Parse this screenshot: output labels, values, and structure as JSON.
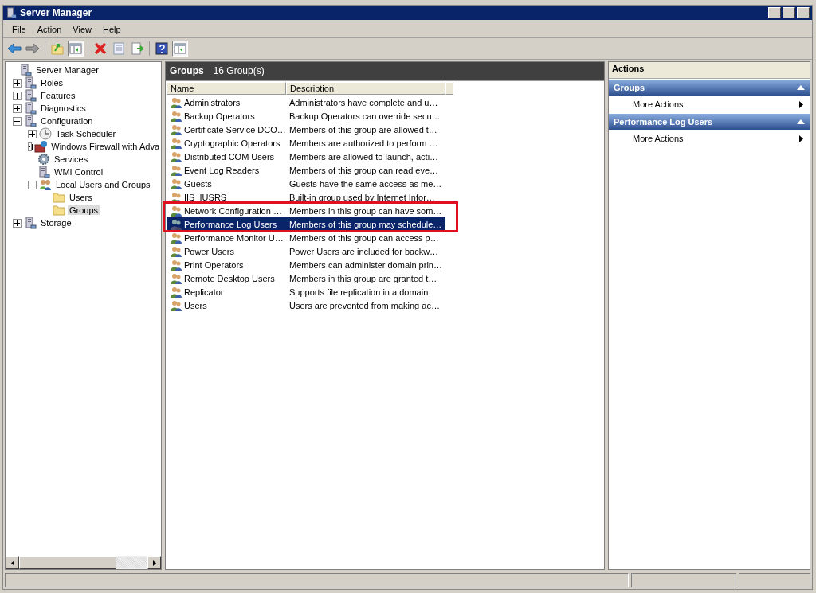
{
  "window": {
    "title": "Server Manager"
  },
  "menu": [
    "File",
    "Action",
    "View",
    "Help"
  ],
  "toolbar": [
    {
      "kind": "back",
      "pressed": false
    },
    {
      "kind": "forward",
      "pressed": false
    },
    {
      "kind": "sep"
    },
    {
      "kind": "up",
      "pressed": false
    },
    {
      "kind": "pane",
      "pressed": true
    },
    {
      "kind": "sep"
    },
    {
      "kind": "delete",
      "pressed": false
    },
    {
      "kind": "properties",
      "pressed": false
    },
    {
      "kind": "export",
      "pressed": false
    },
    {
      "kind": "sep"
    },
    {
      "kind": "help",
      "pressed": false
    },
    {
      "kind": "pane",
      "pressed": true
    }
  ],
  "tree": [
    {
      "label": "Server Manager",
      "kind": "server",
      "selected": false,
      "children": [
        {
          "label": "Roles",
          "kind": "server",
          "expanded": false,
          "selected": false
        },
        {
          "label": "Features",
          "kind": "server",
          "expanded": false,
          "selected": false
        },
        {
          "label": "Diagnostics",
          "kind": "server",
          "expanded": false,
          "selected": false
        },
        {
          "label": "Configuration",
          "kind": "server",
          "expanded": true,
          "selected": false,
          "children": [
            {
              "label": "Task Scheduler",
              "kind": "clock",
              "expanded": false,
              "selected": false
            },
            {
              "label": "Windows Firewall with Adva",
              "kind": "wall",
              "expanded": false,
              "selected": false
            },
            {
              "label": "Services",
              "kind": "gear",
              "selected": false
            },
            {
              "label": "WMI Control",
              "kind": "server",
              "selected": false
            },
            {
              "label": "Local Users and Groups",
              "kind": "users",
              "expanded": true,
              "selected": false,
              "children": [
                {
                  "label": "Users",
                  "kind": "folder",
                  "selected": false
                },
                {
                  "label": "Groups",
                  "kind": "folder",
                  "selected": true
                }
              ]
            }
          ]
        },
        {
          "label": "Storage",
          "kind": "server",
          "expanded": false,
          "selected": false
        }
      ]
    }
  ],
  "groups": {
    "title": "Groups",
    "count": "16 Group(s)",
    "columns": [
      "Name",
      "Description"
    ],
    "rows": [
      {
        "name": "Administrators",
        "description": "Administrators have complete and u…",
        "selected": false,
        "annotated": false
      },
      {
        "name": "Backup Operators",
        "description": "Backup Operators can override secu…",
        "selected": false,
        "annotated": false
      },
      {
        "name": "Certificate Service DCO…",
        "description": "Members of this group are allowed t…",
        "selected": false,
        "annotated": false
      },
      {
        "name": "Cryptographic Operators",
        "description": "Members are authorized to perform …",
        "selected": false,
        "annotated": false
      },
      {
        "name": "Distributed COM Users",
        "description": "Members are allowed to launch, acti…",
        "selected": false,
        "annotated": false
      },
      {
        "name": "Event Log Readers",
        "description": "Members of this group can read eve…",
        "selected": false,
        "annotated": false
      },
      {
        "name": "Guests",
        "description": "Guests have the same access as me…",
        "selected": false,
        "annotated": false
      },
      {
        "name": "IIS_IUSRS",
        "description": "Built-in group used by Internet Infor…",
        "selected": false,
        "annotated": false
      },
      {
        "name": "Network Configuration …",
        "description": "Members in this group can have som…",
        "selected": false,
        "annotated": true
      },
      {
        "name": "Performance Log Users",
        "description": "Members of this group may schedule…",
        "selected": true,
        "annotated": true
      },
      {
        "name": "Performance Monitor U…",
        "description": "Members of this group can access p…",
        "selected": false,
        "annotated": false
      },
      {
        "name": "Power Users",
        "description": "Power Users are included for backw…",
        "selected": false,
        "annotated": false
      },
      {
        "name": "Print Operators",
        "description": "Members can administer domain prin…",
        "selected": false,
        "annotated": false
      },
      {
        "name": "Remote Desktop Users",
        "description": "Members in this group are granted t…",
        "selected": false,
        "annotated": false
      },
      {
        "name": "Replicator",
        "description": "Supports file replication in a domain",
        "selected": false,
        "annotated": false
      },
      {
        "name": "Users",
        "description": "Users are prevented from making ac…",
        "selected": false,
        "annotated": false
      }
    ]
  },
  "actions": {
    "title": "Actions",
    "sections": [
      {
        "title": "Groups",
        "expanded": true,
        "items": [
          "More Actions"
        ]
      },
      {
        "title": "Performance Log Users",
        "expanded": true,
        "items": [
          "More Actions"
        ]
      }
    ]
  }
}
